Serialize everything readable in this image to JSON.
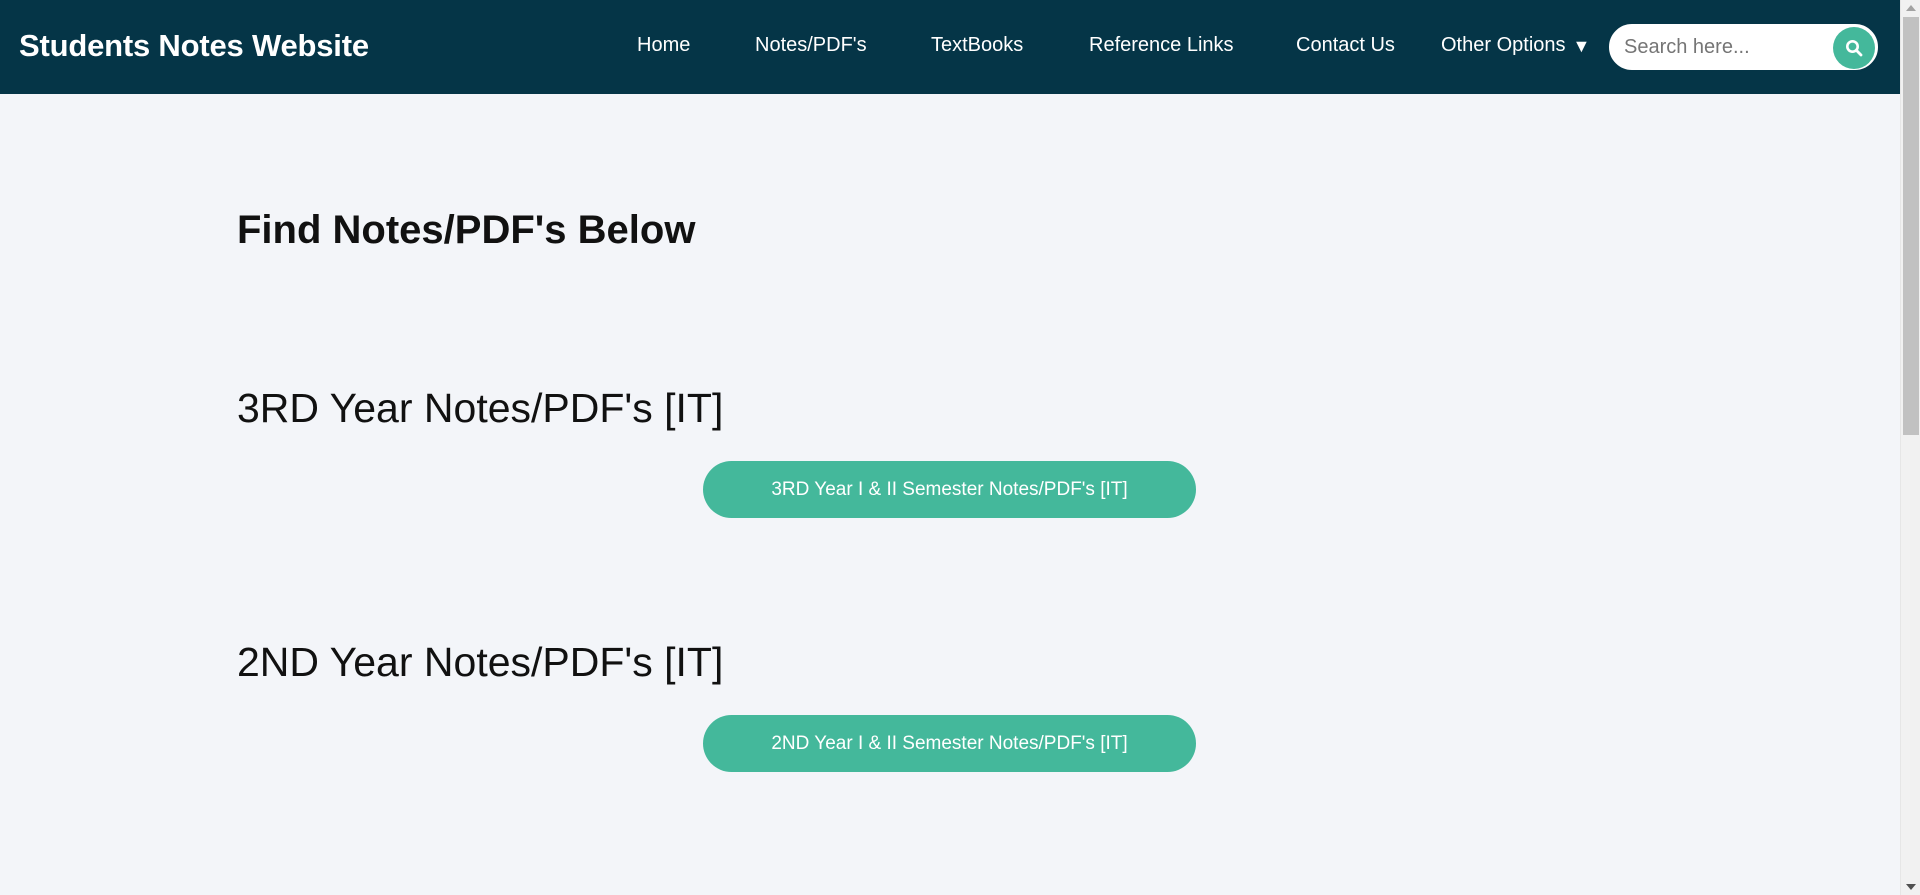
{
  "navbar": {
    "brand": "Students Notes Website",
    "links": [
      {
        "label": "Home"
      },
      {
        "label": "Notes/PDF's"
      },
      {
        "label": "TextBooks"
      },
      {
        "label": "Reference Links"
      },
      {
        "label": "Contact Us"
      }
    ],
    "other_options": {
      "label": "Other Options",
      "caret": "▼"
    },
    "search": {
      "placeholder": "Search here...",
      "value": "",
      "icon": "search-icon"
    }
  },
  "main": {
    "title": "Find Notes/PDF's Below",
    "sections": [
      {
        "heading": "3RD Year Notes/PDF's [IT]",
        "button": "3RD Year I & II Semester Notes/PDF's [IT]"
      },
      {
        "heading": "2ND Year Notes/PDF's [IT]",
        "button": "2ND Year I & II Semester Notes/PDF's [IT]"
      }
    ]
  },
  "colors": {
    "navbar_bg": "#053547",
    "accent": "#44b89b",
    "page_bg": "#f3f5f9",
    "text": "#111111"
  }
}
